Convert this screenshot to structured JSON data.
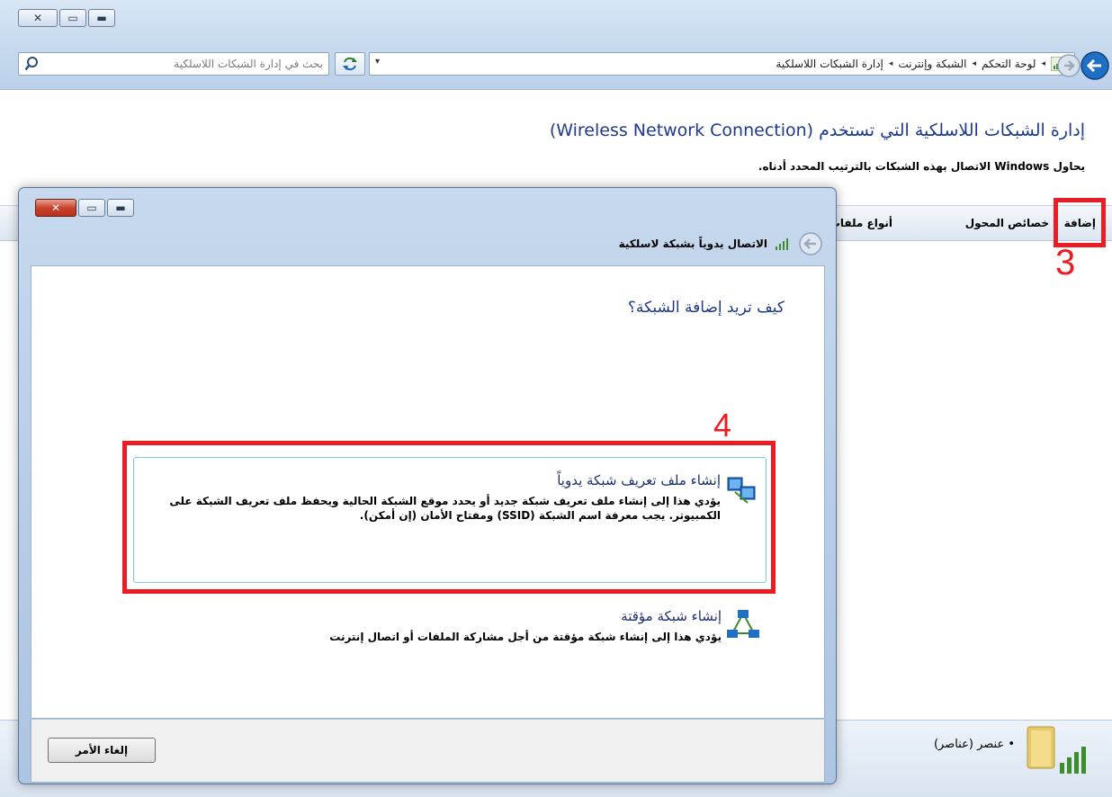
{
  "main_window": {
    "caption_buttons": {
      "close": "✕",
      "maximize": "▭",
      "minimize": "▬"
    },
    "search": {
      "placeholder": "بحث في إدارة الشبكات اللاسلكية",
      "icon": "search-icon"
    },
    "address": {
      "dropdown": "▾",
      "breadcrumb": [
        "لوحة التحكم",
        "الشبكة وإنترنت",
        "إدارة الشبكات اللاسلكية"
      ],
      "separator": "◂"
    },
    "content": {
      "title": "إدارة الشبكات اللاسلكية التي تستخدم (Wireless Network Connection)",
      "description": "يحاول Windows الاتصال بهذه الشبكات بالترتيب المحدد أدناه."
    },
    "command_bar": {
      "add": "إضافة",
      "adapter_properties": "خصائص المحول",
      "profile_types": "أنواع ملفات التع"
    },
    "details": {
      "count_text": "• عنصر (عناصر)"
    },
    "annotation_3": "3"
  },
  "dialog": {
    "caption_buttons": {
      "close": "✕",
      "maximize": "▭",
      "minimize": "▬"
    },
    "nav_title": "الاتصال يدوياً بشبكة لاسلكية",
    "question": "كيف تريد إضافة الشبكة؟",
    "options": [
      {
        "title": "إنشاء ملف تعريف شبكة يدوياً",
        "description": "يؤدي هذا إلى إنشاء ملف تعريف شبكة جديد أو يحدد موقع الشبكة الحالية ويحفظ ملف تعريف الشبكة على الكمبيوتر. يجب معرفة اسم الشبكة (SSID) ومفتاح الأمان (إن أمكن).",
        "icon": "network-computers-icon"
      },
      {
        "title": "إنشاء شبكة مؤقتة",
        "description": "يؤدي هذا إلى إنشاء شبكة مؤقتة من أجل مشاركة الملفات أو اتصال إنترنت",
        "icon": "adhoc-network-icon"
      }
    ],
    "cancel": "إلغاء الأمر",
    "annotation_4": "4"
  },
  "colors": {
    "annotation": "#ec1c24",
    "title_blue": "#1e3a8a"
  }
}
